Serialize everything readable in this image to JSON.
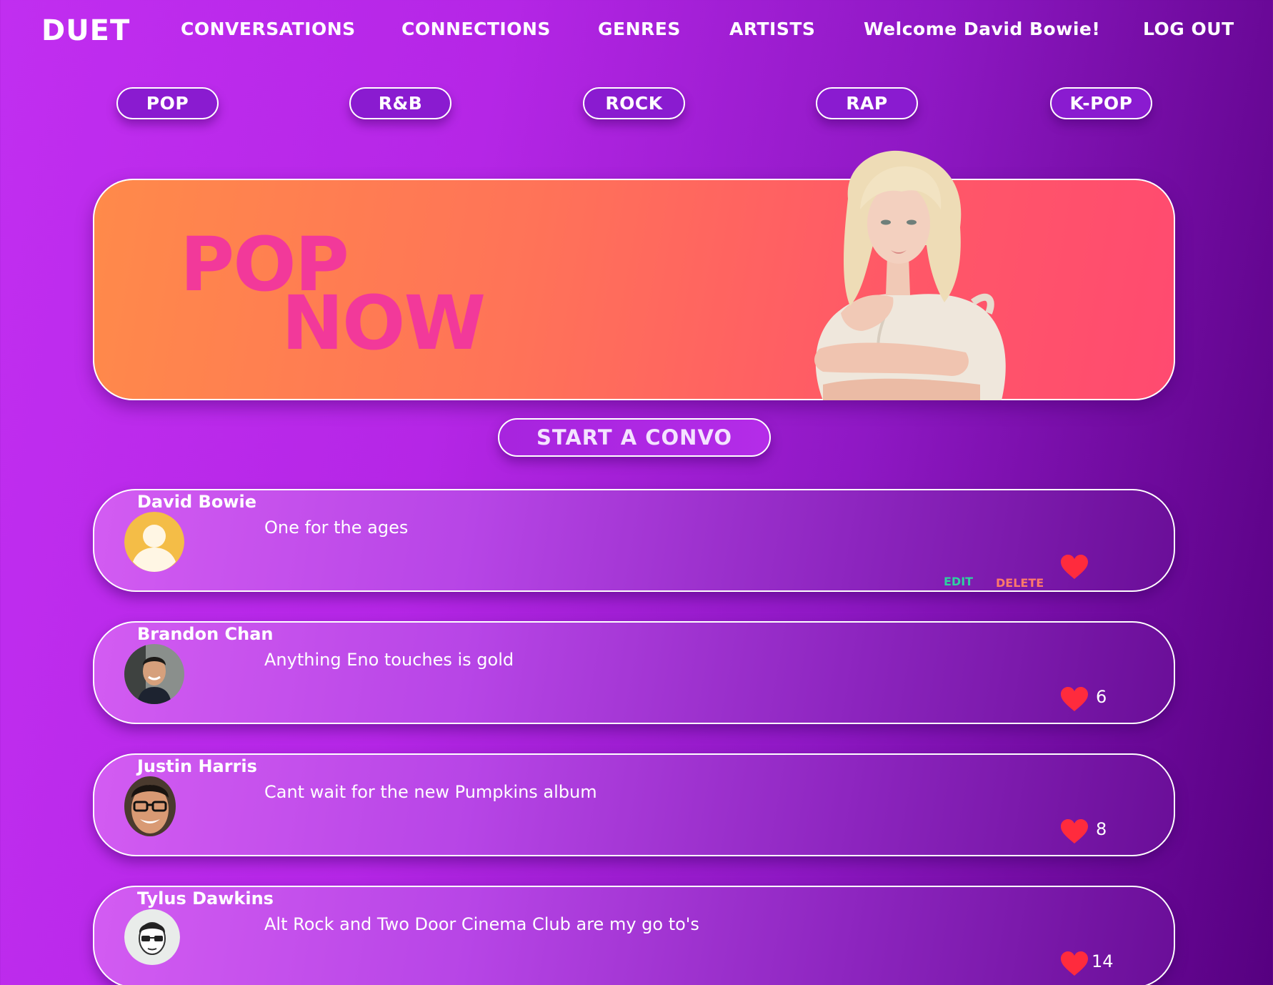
{
  "nav": {
    "logo": "DUET",
    "links": [
      "CONVERSATIONS",
      "CONNECTIONS",
      "GENRES",
      "ARTISTS",
      "Welcome David Bowie!",
      "LOG OUT"
    ]
  },
  "genres": [
    "POP",
    "R&B",
    "ROCK",
    "RAP",
    "K-POP"
  ],
  "hero": {
    "line1": "POP",
    "line2": "NOW"
  },
  "start_button": "START A CONVO",
  "posts": [
    {
      "author": "David Bowie",
      "text": "One for the ages",
      "likes": "",
      "edit": "EDIT",
      "delete": "DELETE",
      "avatar": "default-avatar-icon"
    },
    {
      "author": "Brandon Chan",
      "text": "Anything Eno touches is gold",
      "likes": "6",
      "avatar": "user-photo"
    },
    {
      "author": "Justin Harris",
      "text": "Cant wait for the new Pumpkins album",
      "likes": "8",
      "avatar": "user-photo"
    },
    {
      "author": "Tylus Dawkins",
      "text": "Alt Rock and Two Door Cinema Club are my go to's",
      "likes": "14",
      "avatar": "user-cartoon-avatar"
    }
  ],
  "colors": {
    "accent_pink": "#f2399a",
    "heart_red": "#ff2b3d",
    "edit_green": "#2fd0a0",
    "delete_red": "#ff7a6a"
  }
}
